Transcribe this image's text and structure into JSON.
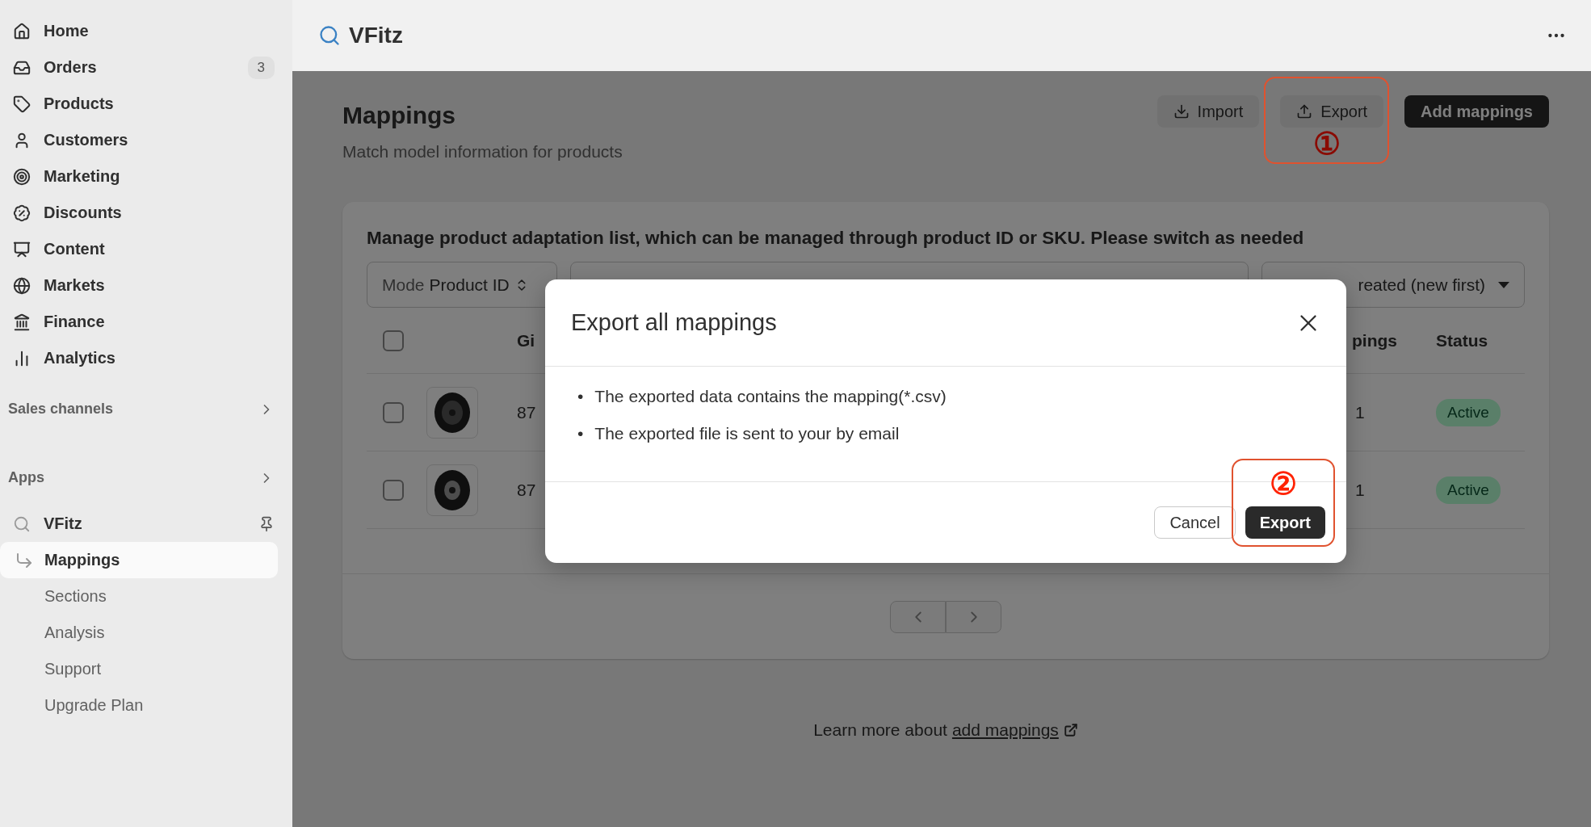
{
  "sidebar": {
    "items": [
      {
        "label": "Home"
      },
      {
        "label": "Orders",
        "badge": "3"
      },
      {
        "label": "Products"
      },
      {
        "label": "Customers"
      },
      {
        "label": "Marketing"
      },
      {
        "label": "Discounts"
      },
      {
        "label": "Content"
      },
      {
        "label": "Markets"
      },
      {
        "label": "Finance"
      },
      {
        "label": "Analytics"
      }
    ],
    "sections": [
      {
        "label": "Sales channels"
      },
      {
        "label": "Apps"
      }
    ],
    "app": {
      "name": "VFitz",
      "subitems": [
        {
          "label": "Mappings",
          "selected": true
        },
        {
          "label": "Sections",
          "selected": false
        },
        {
          "label": "Analysis",
          "selected": false
        },
        {
          "label": "Support",
          "selected": false
        },
        {
          "label": "Upgrade Plan",
          "selected": false
        }
      ]
    }
  },
  "header": {
    "app_name": "VFitz"
  },
  "page": {
    "title": "Mappings",
    "subtitle": "Match model information for products",
    "actions": [
      {
        "label": "Import",
        "kind": "import"
      },
      {
        "label": "Export",
        "kind": "export"
      },
      {
        "label": "Add mappings",
        "kind": "primary"
      }
    ]
  },
  "card": {
    "heading": "Manage product adaptation list, which can be managed through product ID or SKU. Please switch as needed",
    "mode": {
      "label": "Mode",
      "value": "Product ID"
    },
    "sort": {
      "value": "reated (new first)"
    },
    "columns": {
      "column_3": "Gi",
      "column_4": "pings",
      "status": "Status"
    },
    "header_checked": false,
    "rows": [
      {
        "checked": false,
        "column_3": "87",
        "column_4": "1",
        "status": "Active"
      },
      {
        "checked": false,
        "column_3": "87",
        "column_4": "1",
        "status": "Active"
      }
    ]
  },
  "learn_more": {
    "text": "Learn more about",
    "link": "add mappings"
  },
  "modal": {
    "title": "Export all mappings",
    "bullets": [
      {
        "marker": "•",
        "text": "The exported data contains the mapping(*.csv)"
      },
      {
        "marker": "•",
        "text": "The exported file is sent to your by email"
      }
    ],
    "buttons": [
      {
        "label": "Cancel",
        "kind": "secondary"
      },
      {
        "label": "Export",
        "kind": "primary"
      }
    ]
  },
  "annotations": [
    "①",
    "②"
  ]
}
